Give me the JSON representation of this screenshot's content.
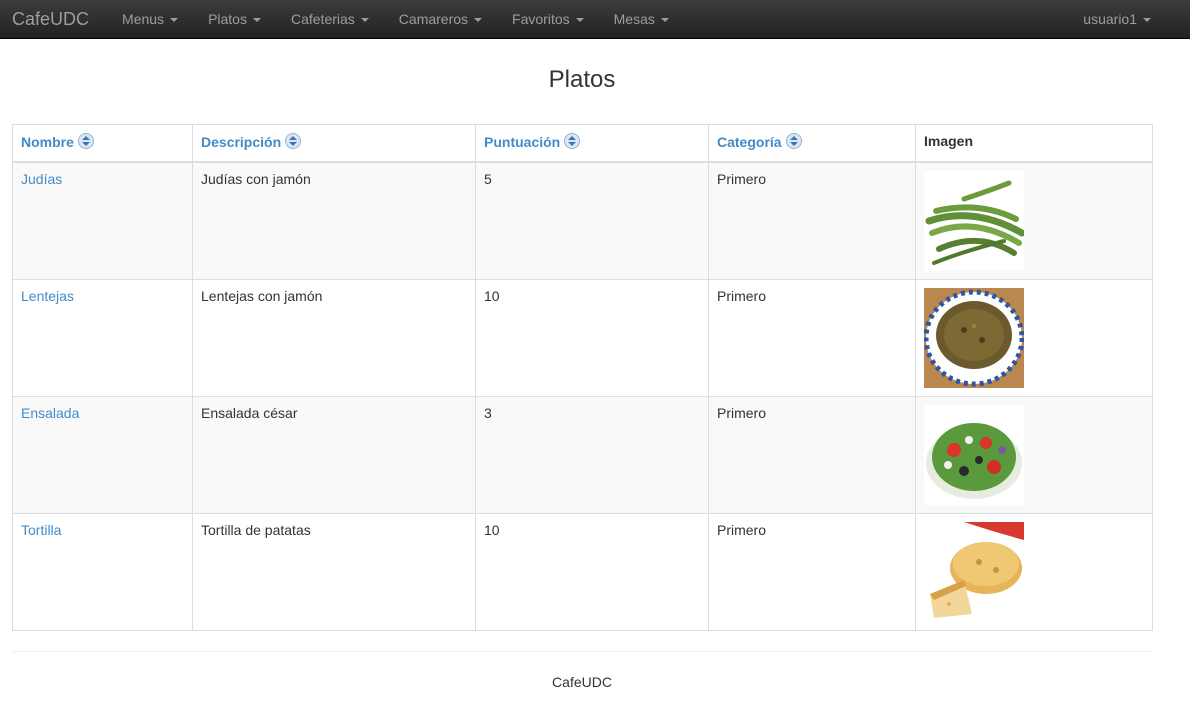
{
  "navbar": {
    "brand": "CafeUDC",
    "items": [
      {
        "label": "Menus"
      },
      {
        "label": "Platos"
      },
      {
        "label": "Cafeterias"
      },
      {
        "label": "Camareros"
      },
      {
        "label": "Favoritos"
      },
      {
        "label": "Mesas"
      }
    ],
    "user": "usuario1"
  },
  "page": {
    "title": "Platos"
  },
  "table": {
    "headers": {
      "nombre": "Nombre",
      "descripcion": "Descripción",
      "puntuacion": "Puntuación",
      "categoria": "Categoría",
      "imagen": "Imagen"
    },
    "rows": [
      {
        "nombre": "Judías",
        "descripcion": "Judías con jamón",
        "puntuacion": "5",
        "categoria": "Primero",
        "imagen": "green-beans-photo"
      },
      {
        "nombre": "Lentejas",
        "descripcion": "Lentejas con jamón",
        "puntuacion": "10",
        "categoria": "Primero",
        "imagen": "lentil-soup-photo"
      },
      {
        "nombre": "Ensalada",
        "descripcion": "Ensalada césar",
        "puntuacion": "3",
        "categoria": "Primero",
        "imagen": "salad-photo"
      },
      {
        "nombre": "Tortilla",
        "descripcion": "Tortilla de patatas",
        "puntuacion": "10",
        "categoria": "Primero",
        "imagen": "spanish-omelette-photo"
      }
    ]
  },
  "footer": {
    "text": "CafeUDC"
  },
  "colors": {
    "link": "#428bca",
    "navbar": "#222222",
    "navText": "#9d9d9d"
  }
}
